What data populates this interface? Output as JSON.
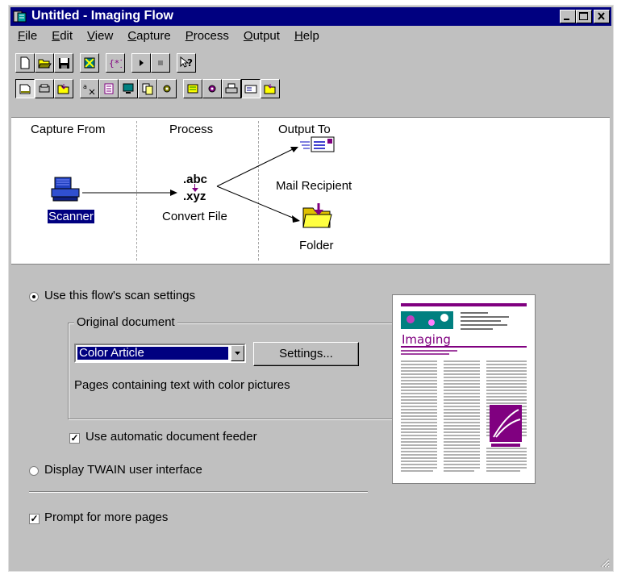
{
  "window": {
    "title": "Untitled - Imaging Flow"
  },
  "menu": [
    "File",
    "Edit",
    "View",
    "Capture",
    "Process",
    "Output",
    "Help"
  ],
  "menu_mnemonics": [
    "F",
    "E",
    "V",
    "C",
    "P",
    "O",
    "H"
  ],
  "flow": {
    "headers": {
      "capture": "Capture From",
      "process": "Process",
      "output": "Output To"
    },
    "capture_node": "Scanner",
    "process_node": "Convert File",
    "process_icon_text": {
      "top": ".abc",
      "bottom": ".xyz"
    },
    "outputs": [
      "Mail Recipient",
      "Folder"
    ]
  },
  "scan": {
    "use_flow_settings": "Use this flow's scan settings",
    "original_document_title": "Original document",
    "document_type": "Color Article",
    "settings_button": "Settings...",
    "description": "Pages containing text with color pictures",
    "adf_label": "Use automatic document feeder",
    "adf_checked": true,
    "twain_label": "Display TWAIN user interface",
    "prompt_more_pages": "Prompt for more pages",
    "prompt_checked": true,
    "selected_mode": "use_flow_settings"
  },
  "preview": {
    "article_title": "Imaging"
  },
  "colors": {
    "titlebar": "#000080",
    "accent": "#800080",
    "selection": "#000080"
  }
}
